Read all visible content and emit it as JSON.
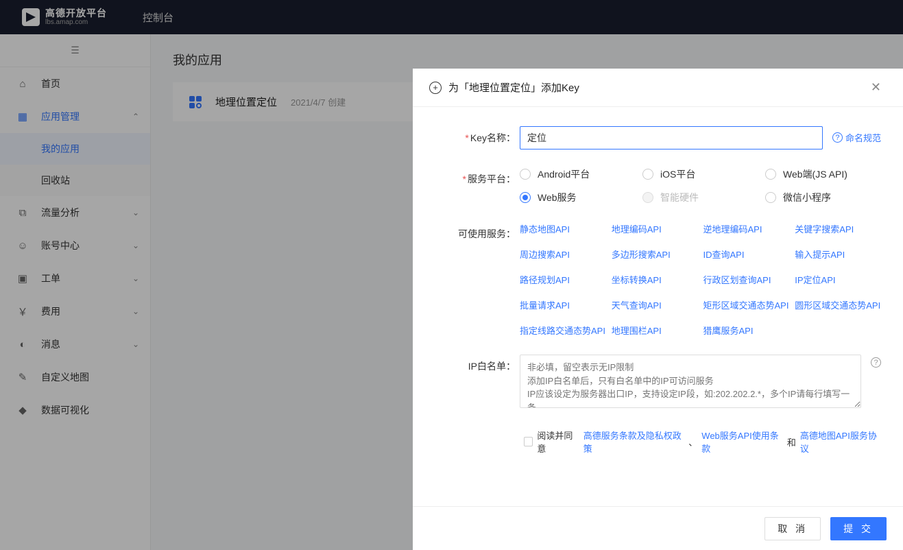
{
  "topbar": {
    "logo_title": "高德开放平台",
    "logo_sub": "lbs.amap.com",
    "console": "控制台"
  },
  "sidebar": {
    "items": [
      {
        "icon": "⌂",
        "label": "首页"
      },
      {
        "icon": "▦",
        "label": "应用管理",
        "expanded": true
      },
      {
        "icon": "⧉",
        "label": "流量分析",
        "chev": "⌄"
      },
      {
        "icon": "☺",
        "label": "账号中心",
        "chev": "⌄"
      },
      {
        "icon": "▣",
        "label": "工单",
        "chev": "⌄"
      },
      {
        "icon": "￥",
        "label": "费用",
        "chev": "⌄"
      },
      {
        "icon": "◐",
        "label": "消息",
        "chev": "⌄"
      },
      {
        "icon": "✎",
        "label": "自定义地图"
      },
      {
        "icon": "◆",
        "label": "数据可视化"
      }
    ],
    "sub": {
      "my_apps": "我的应用",
      "recycle": "回收站"
    }
  },
  "main": {
    "title": "我的应用",
    "app_name": "地理位置定位",
    "app_date": "2021/4/7 创建"
  },
  "modal": {
    "title": "为「地理位置定位」添加Key",
    "labels": {
      "key_name": "Key名称：",
      "platform": "服务平台：",
      "services": "可使用服务：",
      "ip_whitelist": "IP白名单："
    },
    "key_name_value": "定位",
    "help_link": "命名规范",
    "platforms": [
      {
        "label": "Android平台",
        "state": ""
      },
      {
        "label": "iOS平台",
        "state": ""
      },
      {
        "label": "Web端(JS API)",
        "state": ""
      },
      {
        "label": "Web服务",
        "state": "selected"
      },
      {
        "label": "智能硬件",
        "state": "disabled"
      },
      {
        "label": "微信小程序",
        "state": ""
      }
    ],
    "services": [
      "静态地图API",
      "地理编码API",
      "逆地理编码API",
      "关键字搜索API",
      "周边搜索API",
      "多边形搜索API",
      "ID查询API",
      "输入提示API",
      "路径规划API",
      "坐标转换API",
      "行政区划查询API",
      "IP定位API",
      "批量请求API",
      "天气查询API",
      "矩形区域交通态势API",
      "圆形区域交通态势API",
      "指定线路交通态势API",
      "地理围栏API",
      "猎鹰服务API"
    ],
    "ip_placeholder": "非必填，留空表示无IP限制\n添加IP白名单后，只有白名单中的IP可访问服务\nIP应该设定为服务器出口IP，支持设定IP段，如:202.202.2.*，多个IP请每行填写一条",
    "agree": {
      "prefix": "阅读并同意",
      "link1": "高德服务条款及隐私权政策",
      "sep1": "、",
      "link2": "Web服务API使用条款",
      "and": "和",
      "link3": "高德地图API服务协议"
    },
    "buttons": {
      "cancel": "取 消",
      "submit": "提 交"
    }
  }
}
